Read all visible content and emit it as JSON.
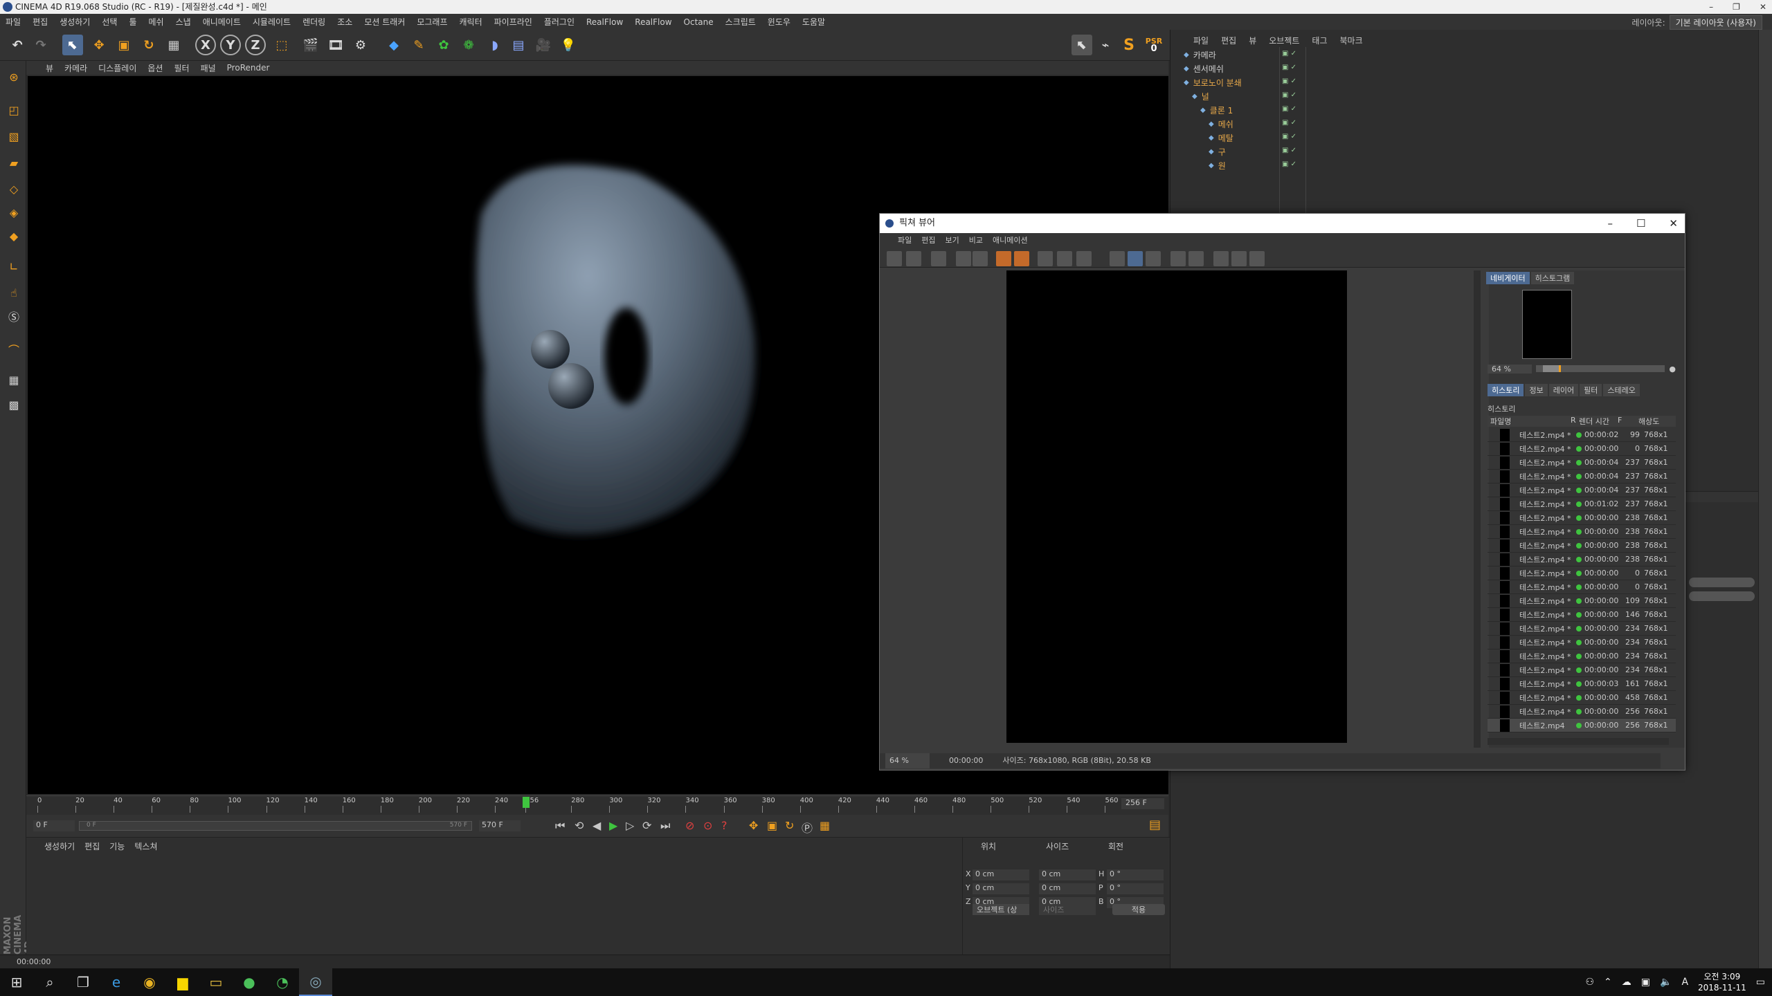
{
  "window": {
    "title": "CINEMA 4D R19.068 Studio (RC - R19) - [제질완성.c4d *] - 메인"
  },
  "menubar": [
    "파일",
    "편집",
    "생성하기",
    "선택",
    "툴",
    "메쉬",
    "스냅",
    "애니메이트",
    "시뮬레이트",
    "렌더링",
    "조소",
    "모션 트래커",
    "모그래프",
    "캐릭터",
    "파이프라인",
    "플러그인",
    "RealFlow",
    "RealFlow",
    "Octane",
    "스크립트",
    "윈도우",
    "도움말"
  ],
  "layout": {
    "label": "레이아웃:",
    "value": "기본 레이아웃 (사용자)"
  },
  "viewport_menu": [
    "뷰",
    "카메라",
    "디스플레이",
    "옵션",
    "필터",
    "패널",
    "ProRender"
  ],
  "toolbar_icons": [
    "undo-icon",
    "redo-icon",
    "select-icon",
    "move-icon",
    "scale-icon",
    "rotate-icon",
    "recent-tool-icon",
    "x-axis-icon",
    "y-axis-icon",
    "z-axis-icon",
    "coord-system-icon",
    "render-view-icon",
    "render-picture-viewer-icon",
    "render-settings-icon",
    "cube-icon",
    "pen-icon",
    "subdivision-icon",
    "array-icon",
    "deformer-icon",
    "floor-icon",
    "camera-icon",
    "light-icon"
  ],
  "toolbar_labels": {
    "x": "X",
    "y": "Y",
    "z": "Z",
    "psr": "PSR",
    "psr_val": "0"
  },
  "objects": [
    {
      "name": "카메라",
      "level": 0,
      "color": "#cfcfcf"
    },
    {
      "name": "센서메쉬",
      "level": 0,
      "color": "#cfcfcf"
    },
    {
      "name": "보로노이 분쇄",
      "level": 0,
      "color": "#e8a94a"
    },
    {
      "name": "널",
      "level": 1,
      "color": "#e8a94a"
    },
    {
      "name": "클론 1",
      "level": 2,
      "color": "#e8a94a"
    },
    {
      "name": "메쉬",
      "level": 3,
      "color": "#e8a94a"
    },
    {
      "name": "메탈",
      "level": 3,
      "color": "#e8a94a"
    },
    {
      "name": "구",
      "level": 3,
      "color": "#e8a94a"
    },
    {
      "name": "원",
      "level": 3,
      "color": "#e8a94a"
    }
  ],
  "object_menu": [
    "파일",
    "편집",
    "뷰",
    "오브젝트",
    "태그",
    "북마크"
  ],
  "timeline": {
    "ticks": [
      "0",
      "20",
      "40",
      "60",
      "80",
      "100",
      "120",
      "140",
      "160",
      "180",
      "200",
      "220",
      "240",
      "256",
      "280",
      "300",
      "320",
      "340",
      "360",
      "380",
      "400",
      "420",
      "440",
      "460",
      "480",
      "500",
      "520",
      "540",
      "560"
    ],
    "current": 256,
    "current_label": "256 F",
    "start": "0 F",
    "end": "570 F",
    "range_start": "0 F",
    "range_end": "570 F"
  },
  "material_menu": [
    "생성하기",
    "편집",
    "기능",
    "텍스쳐"
  ],
  "coordinates": {
    "headers": [
      "위치",
      "사이즈",
      "회전"
    ],
    "rows": [
      {
        "axis": "X",
        "pos": "0 cm",
        "size": "0 cm",
        "rot_label": "H",
        "rot": "0 °"
      },
      {
        "axis": "Y",
        "pos": "0 cm",
        "size": "0 cm",
        "rot_label": "P",
        "rot": "0 °"
      },
      {
        "axis": "Z",
        "pos": "0 cm",
        "size": "0 cm",
        "rot_label": "B",
        "rot": "0 °"
      }
    ],
    "mode": "오브젝트 (상",
    "size_mode": "사이즈",
    "apply": "적용"
  },
  "status_text": "00:00:00",
  "picture_viewer": {
    "title": "픽쳐 뷰어",
    "menu": [
      "파일",
      "편집",
      "보기",
      "비교",
      "애니메이션"
    ],
    "zoom": "64 %",
    "time": "00:00:00",
    "info": "사이즈: 768x1080, RGB (8Bit), 20.58 KB",
    "nav_tabs": [
      "네비게이터",
      "히스토그램"
    ],
    "nav_zoom": "64 %",
    "tabs": [
      "히스토리",
      "정보",
      "레이어",
      "필터",
      "스테레오"
    ],
    "history_label": "히스토리",
    "columns": [
      "파일명",
      "R",
      "렌더 시간",
      "F",
      "해상도"
    ],
    "rows": [
      {
        "name": "테스트2.mp4 *",
        "time": "00:00:02",
        "frame": "99",
        "res": "768x1"
      },
      {
        "name": "테스트2.mp4 *",
        "time": "00:00:00",
        "frame": "0",
        "res": "768x1"
      },
      {
        "name": "테스트2.mp4 *",
        "time": "00:00:04",
        "frame": "237",
        "res": "768x1"
      },
      {
        "name": "테스트2.mp4 *",
        "time": "00:00:04",
        "frame": "237",
        "res": "768x1"
      },
      {
        "name": "테스트2.mp4 *",
        "time": "00:00:04",
        "frame": "237",
        "res": "768x1"
      },
      {
        "name": "테스트2.mp4 *",
        "time": "00:01:02",
        "frame": "237",
        "res": "768x1"
      },
      {
        "name": "테스트2.mp4 *",
        "time": "00:00:00",
        "frame": "238",
        "res": "768x1"
      },
      {
        "name": "테스트2.mp4 *",
        "time": "00:00:00",
        "frame": "238",
        "res": "768x1"
      },
      {
        "name": "테스트2.mp4 *",
        "time": "00:00:00",
        "frame": "238",
        "res": "768x1"
      },
      {
        "name": "테스트2.mp4 *",
        "time": "00:00:00",
        "frame": "238",
        "res": "768x1"
      },
      {
        "name": "테스트2.mp4 *",
        "time": "00:00:00",
        "frame": "0",
        "res": "768x1"
      },
      {
        "name": "테스트2.mp4 *",
        "time": "00:00:00",
        "frame": "0",
        "res": "768x1"
      },
      {
        "name": "테스트2.mp4 *",
        "time": "00:00:00",
        "frame": "109",
        "res": "768x1"
      },
      {
        "name": "테스트2.mp4 *",
        "time": "00:00:00",
        "frame": "146",
        "res": "768x1"
      },
      {
        "name": "테스트2.mp4 *",
        "time": "00:00:00",
        "frame": "234",
        "res": "768x1"
      },
      {
        "name": "테스트2.mp4 *",
        "time": "00:00:00",
        "frame": "234",
        "res": "768x1"
      },
      {
        "name": "테스트2.mp4 *",
        "time": "00:00:00",
        "frame": "234",
        "res": "768x1"
      },
      {
        "name": "테스트2.mp4 *",
        "time": "00:00:00",
        "frame": "234",
        "res": "768x1"
      },
      {
        "name": "테스트2.mp4 *",
        "time": "00:00:03",
        "frame": "161",
        "res": "768x1"
      },
      {
        "name": "테스트2.mp4 *",
        "time": "00:00:00",
        "frame": "458",
        "res": "768x1"
      },
      {
        "name": "테스트2.mp4 *",
        "time": "00:00:00",
        "frame": "256",
        "res": "768x1"
      },
      {
        "name": "테스트2.mp4",
        "time": "00:00:00",
        "frame": "256",
        "res": "768x1"
      }
    ]
  },
  "taskbar": {
    "icons": [
      "windows-start-icon",
      "search-icon",
      "task-view-icon",
      "edge-icon",
      "chrome-icon",
      "kakaotalk-icon",
      "file-explorer-icon",
      "kakao-icon",
      "phone-icon",
      "cinema4d-icon"
    ],
    "clock_time": "오전 3:09",
    "clock_date": "2018-11-11",
    "lang": "A"
  },
  "branding": "MAXON CINEMA 4D",
  "colors": {
    "accent": "#4d6a92",
    "orange": "#e8a94a",
    "play": "#3fc43f"
  }
}
